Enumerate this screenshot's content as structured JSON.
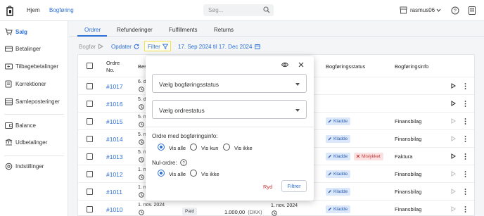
{
  "topbar": {
    "nav": [
      "Hjem",
      "Bogføring"
    ],
    "search_placeholder": "Søg...",
    "user": "rasmus06",
    "icons": [
      "store-logo-icon",
      "search-icon",
      "store-icon",
      "chevron-down-icon",
      "help-icon",
      "grid-icon"
    ]
  },
  "sidebar": {
    "items": [
      {
        "label": "Salg",
        "icon": "cart-icon",
        "active": true
      },
      {
        "label": "Betalinger",
        "icon": "payments-icon"
      },
      {
        "label": "Tilbagebetalinger",
        "icon": "refund-icon"
      },
      {
        "label": "Korrektioner",
        "icon": "correction-icon"
      },
      {
        "label": "Samleposteringer",
        "icon": "collective-posting-icon"
      },
      {
        "label": "Balance",
        "icon": "balance-icon"
      },
      {
        "label": "Udbetalinger",
        "icon": "payout-icon"
      },
      {
        "label": "Indstillinger",
        "icon": "settings-icon"
      }
    ]
  },
  "tabs": [
    "Ordrer",
    "Refunderinger",
    "Fulfillments",
    "Returns"
  ],
  "toolbar": {
    "bogfor": "Bogfør",
    "opdater": "Opdater",
    "filter": "Filter",
    "date_range": "17. Sep 2024 til 17. Dec 2024"
  },
  "table": {
    "headers": {
      "order": "Ordre\nNo.",
      "order_l1": "Ordre",
      "order_l2": "No.",
      "date": "Besti",
      "status": "Bogføringsstatus",
      "info": "Bogføringsinfo"
    },
    "rows": [
      {
        "no": "#1017",
        "date": "6. d",
        "chips": [],
        "info": "",
        "play_active": true
      },
      {
        "no": "#1016",
        "date": "5. d",
        "chips": [],
        "info": "",
        "play_active": true
      },
      {
        "no": "#1015",
        "date": "5. n",
        "chips": [
          "Kladde"
        ],
        "info": "Finansbilag",
        "play_active": false
      },
      {
        "no": "#1014",
        "date": "5. n",
        "chips": [
          "Kladde"
        ],
        "info": "Finansbilag",
        "play_active": false
      },
      {
        "no": "#1013",
        "date": "5. n",
        "chips": [
          "Kladde",
          "Mislykket"
        ],
        "info": "Faktura",
        "play_active": true
      },
      {
        "no": "#1012",
        "date": "1. n",
        "chips": [
          "Kladde"
        ],
        "info": "Finansbilag",
        "play_active": false
      },
      {
        "no": "#1011",
        "date": "1. n",
        "chips": [
          "Kladde"
        ],
        "info": "Finansbilag",
        "play_active": false
      },
      {
        "no": "#1010",
        "date": "1. nov. 2024",
        "chips": [
          "Kladde"
        ],
        "info": "Finansbilag",
        "play_active": false,
        "payment": "Paid",
        "amount": "1.000,00",
        "currency": "(DKK)",
        "post_date": "1. nov. 2024"
      }
    ]
  },
  "filter_popup": {
    "status_placeholder": "Vælg bogføringsstatus",
    "order_status_placeholder": "Vælg ordrestatus",
    "bookkeeping_info_label": "Ordre med bogføringsinfo:",
    "bookkeeping_options": [
      "Vis alle",
      "Vis kun",
      "Vis ikke"
    ],
    "bookkeeping_selected": 0,
    "null_orders_label": "Nul-ordre:",
    "null_options": [
      "Vis alle",
      "Vis ikke"
    ],
    "null_selected": 0,
    "clear": "Ryd",
    "apply": "Filtrer"
  },
  "colors": {
    "accent": "#2c6fd6",
    "kladde_bg": "#dbe7fa",
    "mislykket_bg": "#fbe1e1",
    "highlight": "#f0e24a"
  }
}
